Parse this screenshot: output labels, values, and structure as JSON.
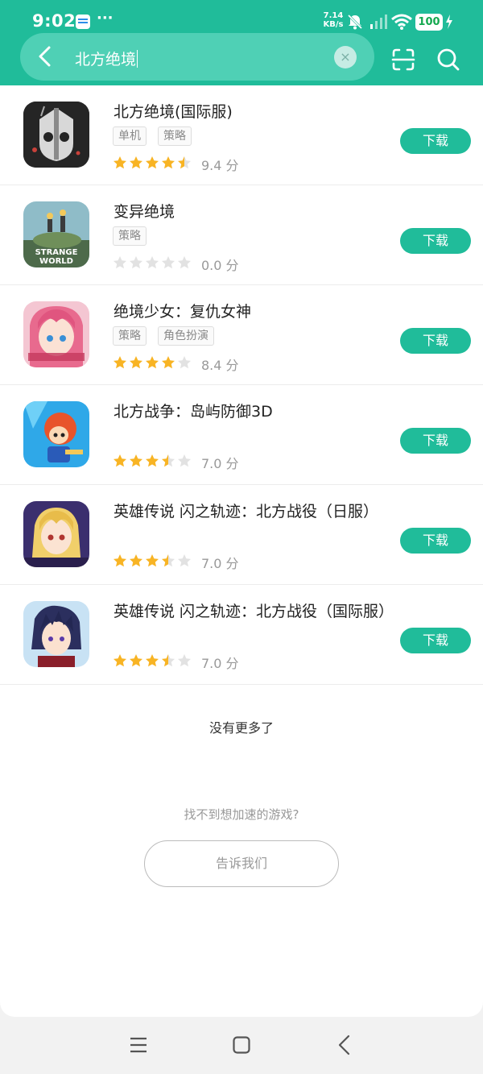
{
  "status_bar": {
    "time": "9:02",
    "more": "···",
    "speed_value": "7.14",
    "speed_unit": "KB/s",
    "battery": "100"
  },
  "search": {
    "query": "北方绝境",
    "clear": "×"
  },
  "results": [
    {
      "title": "北方绝境(国际服)",
      "tags": [
        "单机",
        "策略"
      ],
      "rating": 4.5,
      "score": "9.4 分",
      "button": "下载"
    },
    {
      "title": "变异绝境",
      "tags": [
        "策略"
      ],
      "rating": 0,
      "score": "0.0 分",
      "button": "下载",
      "icon_caption": "STRANGE WORLD"
    },
    {
      "title": "绝境少女：复仇女神",
      "tags": [
        "策略",
        "角色扮演"
      ],
      "rating": 4,
      "score": "8.4 分",
      "button": "下载"
    },
    {
      "title": "北方战争：岛屿防御3D",
      "tags": [],
      "rating": 3.5,
      "score": "7.0 分",
      "button": "下载"
    },
    {
      "title": "英雄传说 闪之轨迹：北方战役（日服）",
      "tags": [],
      "rating": 3.5,
      "score": "7.0 分",
      "button": "下载"
    },
    {
      "title": "英雄传说 闪之轨迹：北方战役（国际服）",
      "tags": [],
      "rating": 3.5,
      "score": "7.0 分",
      "button": "下载"
    }
  ],
  "footer": {
    "no_more": "没有更多了",
    "prompt": "找不到想加速的游戏?",
    "tell_us": "告诉我们"
  },
  "colors": {
    "accent": "#20bc9a",
    "star": "#f8b424",
    "star_empty": "#e2e2e2"
  }
}
